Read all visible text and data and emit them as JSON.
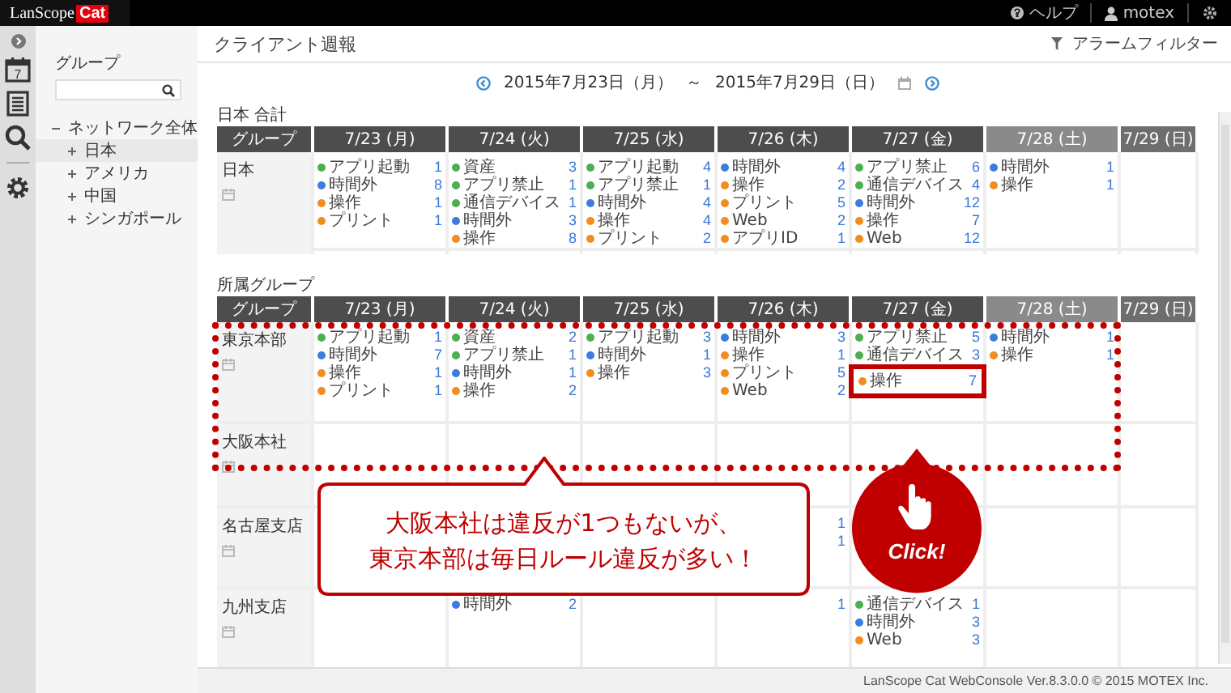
{
  "top_bar": {
    "logo": {
      "text": "LanScope",
      "badge": "Cat"
    },
    "links": [
      {
        "kind": "help",
        "label": "ヘルプ"
      },
      {
        "kind": "user",
        "label": "motex"
      },
      {
        "kind": "settings"
      }
    ]
  },
  "rail": [
    {
      "kind": "collapse"
    },
    {
      "kind": "calendar",
      "text": "7"
    },
    {
      "kind": "report"
    },
    {
      "kind": "search"
    },
    {
      "kind": "settings"
    }
  ],
  "sidebar": {
    "title": "グループ",
    "tree": [
      {
        "label": "ネットワーク全体",
        "expanded": true,
        "selected": false,
        "children": [
          {
            "label": "日本",
            "expanded": false,
            "selected": true
          },
          {
            "label": "アメリカ",
            "expanded": false,
            "selected": false
          },
          {
            "label": "中国",
            "expanded": false,
            "selected": false
          },
          {
            "label": "シンガポール",
            "expanded": false,
            "selected": false
          }
        ]
      }
    ]
  },
  "header": {
    "title": "クライアント週報",
    "filter": "アラームフィルター"
  },
  "date_range": {
    "start": "2015年7月23日（月）",
    "separator": "～",
    "end": "2015年7月29日（日）"
  },
  "sections": [
    {
      "title": "日本 合計",
      "group_header": "グループ",
      "columns": [
        {
          "label": "7/23 (月)",
          "kind": "weekday"
        },
        {
          "label": "7/24 (火)",
          "kind": "weekday"
        },
        {
          "label": "7/25 (水)",
          "kind": "weekday"
        },
        {
          "label": "7/26 (木)",
          "kind": "weekday"
        },
        {
          "label": "7/27 (金)",
          "kind": "weekday"
        },
        {
          "label": "7/28 (土)",
          "kind": "saturday"
        },
        {
          "label": "7/29 (日)",
          "kind": "sunday"
        }
      ],
      "rows": [
        {
          "group": "日本",
          "cells": [
            [
              {
                "label": "アプリ起動",
                "count": "1",
                "color": "#4caf50"
              },
              {
                "label": "時間外",
                "count": "8",
                "color": "#3b7ddd"
              },
              {
                "label": "操作",
                "count": "1",
                "color": "#f28c1e"
              },
              {
                "label": "プリント",
                "count": "1",
                "color": "#f28c1e"
              }
            ],
            [
              {
                "label": "資産",
                "count": "3",
                "color": "#4caf50"
              },
              {
                "label": "アプリ禁止",
                "count": "1",
                "color": "#4caf50"
              },
              {
                "label": "通信デバイス",
                "count": "1",
                "color": "#4caf50"
              },
              {
                "label": "時間外",
                "count": "3",
                "color": "#3b7ddd"
              },
              {
                "label": "操作",
                "count": "8",
                "color": "#f28c1e"
              }
            ],
            [
              {
                "label": "アプリ起動",
                "count": "4",
                "color": "#4caf50"
              },
              {
                "label": "アプリ禁止",
                "count": "1",
                "color": "#4caf50"
              },
              {
                "label": "時間外",
                "count": "4",
                "color": "#3b7ddd"
              },
              {
                "label": "操作",
                "count": "4",
                "color": "#f28c1e"
              },
              {
                "label": "プリント",
                "count": "2",
                "color": "#f28c1e"
              }
            ],
            [
              {
                "label": "時間外",
                "count": "4",
                "color": "#3b7ddd"
              },
              {
                "label": "操作",
                "count": "2",
                "color": "#f28c1e"
              },
              {
                "label": "プリント",
                "count": "5",
                "color": "#f28c1e"
              },
              {
                "label": "Web",
                "count": "2",
                "color": "#f28c1e"
              },
              {
                "label": "アプリID",
                "count": "1",
                "color": "#f28c1e"
              }
            ],
            [
              {
                "label": "アプリ禁止",
                "count": "6",
                "color": "#4caf50"
              },
              {
                "label": "通信デバイス",
                "count": "4",
                "color": "#4caf50"
              },
              {
                "label": "時間外",
                "count": "12",
                "color": "#3b7ddd"
              },
              {
                "label": "操作",
                "count": "7",
                "color": "#f28c1e"
              },
              {
                "label": "Web",
                "count": "12",
                "color": "#f28c1e"
              }
            ],
            [
              {
                "label": "時間外",
                "count": "1",
                "color": "#3b7ddd"
              },
              {
                "label": "操作",
                "count": "1",
                "color": "#f28c1e"
              }
            ],
            []
          ]
        }
      ]
    },
    {
      "title": "所属グループ",
      "group_header": "グループ",
      "columns": [
        {
          "label": "7/23 (月)",
          "kind": "weekday"
        },
        {
          "label": "7/24 (火)",
          "kind": "weekday"
        },
        {
          "label": "7/25 (水)",
          "kind": "weekday"
        },
        {
          "label": "7/26 (木)",
          "kind": "weekday"
        },
        {
          "label": "7/27 (金)",
          "kind": "weekday"
        },
        {
          "label": "7/28 (土)",
          "kind": "saturday"
        },
        {
          "label": "7/29 (日)",
          "kind": "sunday"
        }
      ],
      "rows": [
        {
          "group": "東京本部",
          "cells": [
            [
              {
                "label": "アプリ起動",
                "count": "1",
                "color": "#4caf50"
              },
              {
                "label": "時間外",
                "count": "7",
                "color": "#3b7ddd"
              },
              {
                "label": "操作",
                "count": "1",
                "color": "#f28c1e"
              },
              {
                "label": "プリント",
                "count": "1",
                "color": "#f28c1e"
              }
            ],
            [
              {
                "label": "資産",
                "count": "2",
                "color": "#4caf50"
              },
              {
                "label": "アプリ禁止",
                "count": "1",
                "color": "#4caf50"
              },
              {
                "label": "時間外",
                "count": "1",
                "color": "#3b7ddd"
              },
              {
                "label": "操作",
                "count": "2",
                "color": "#f28c1e"
              }
            ],
            [
              {
                "label": "アプリ起動",
                "count": "3",
                "color": "#4caf50"
              },
              {
                "label": "時間外",
                "count": "1",
                "color": "#3b7ddd"
              },
              {
                "label": "操作",
                "count": "3",
                "color": "#f28c1e"
              }
            ],
            [
              {
                "label": "時間外",
                "count": "3",
                "color": "#3b7ddd"
              },
              {
                "label": "操作",
                "count": "1",
                "color": "#f28c1e"
              },
              {
                "label": "プリント",
                "count": "5",
                "color": "#f28c1e"
              },
              {
                "label": "Web",
                "count": "2",
                "color": "#f28c1e"
              }
            ],
            [
              {
                "label": "アプリ禁止",
                "count": "5",
                "color": "#4caf50"
              },
              {
                "label": "通信デバイス",
                "count": "3",
                "color": "#4caf50"
              },
              {
                "label": "操作",
                "count": "7",
                "color": "#f28c1e",
                "highlighted": true
              }
            ],
            [
              {
                "label": "時間外",
                "count": "1",
                "color": "#3b7ddd"
              },
              {
                "label": "操作",
                "count": "1",
                "color": "#f28c1e"
              }
            ],
            []
          ]
        },
        {
          "group": "大阪本社",
          "cells": [
            [],
            [],
            [],
            [],
            [],
            [],
            []
          ]
        },
        {
          "group": "名古屋支店",
          "cells": [
            [],
            [],
            [],
            [
              {
                "count": "1"
              },
              {
                "count": "1"
              }
            ],
            [],
            [],
            []
          ]
        },
        {
          "group": "九州支店",
          "cells": [
            [],
            [
              {
                "label": "時間外",
                "count": "2",
                "color": "#3b7ddd"
              }
            ],
            [],
            [
              {
                "count": "1"
              }
            ],
            [
              {
                "label": "通信デバイス",
                "count": "1",
                "color": "#4caf50"
              },
              {
                "label": "時間外",
                "count": "3",
                "color": "#3b7ddd"
              },
              {
                "label": "Web",
                "count": "3",
                "color": "#f28c1e"
              }
            ],
            [],
            []
          ]
        }
      ],
      "annotation": {
        "callout_lines": [
          "大阪本社は違反が1つもないが、",
          "東京本部は毎日ルール違反が多い！"
        ],
        "badge": "Click!"
      }
    }
  ],
  "footer": "LanScope Cat WebConsole Ver.8.3.0.0 © 2015 MOTEX Inc."
}
